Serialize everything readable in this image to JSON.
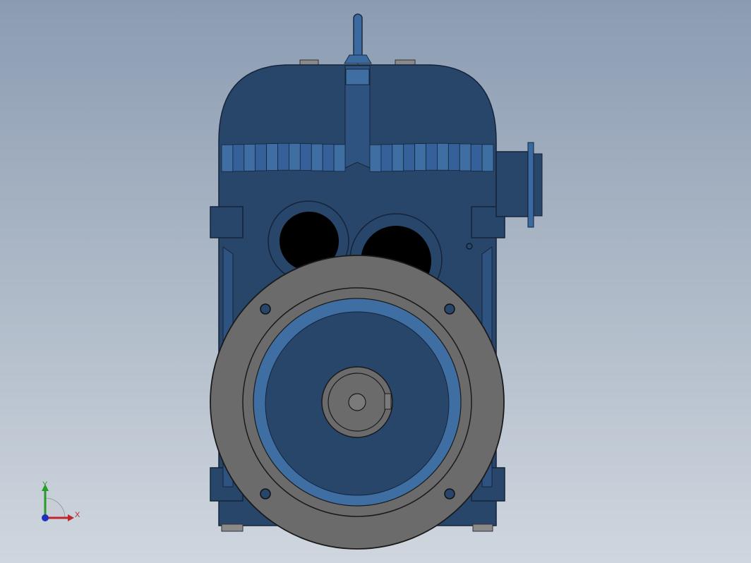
{
  "viewport": {
    "background_top": "#8b9cb2",
    "background_bottom": "#cfd6de"
  },
  "model": {
    "body_color": "#28456a",
    "highlight_color": "#3f6ea3",
    "flange_color": "#6b6b6b",
    "bore_color": "#000000"
  },
  "triad": {
    "x_label": "X",
    "y_label": "Y",
    "x_color": "#c0262b",
    "y_color": "#2a9a2a",
    "z_color": "#1f2fbf"
  }
}
